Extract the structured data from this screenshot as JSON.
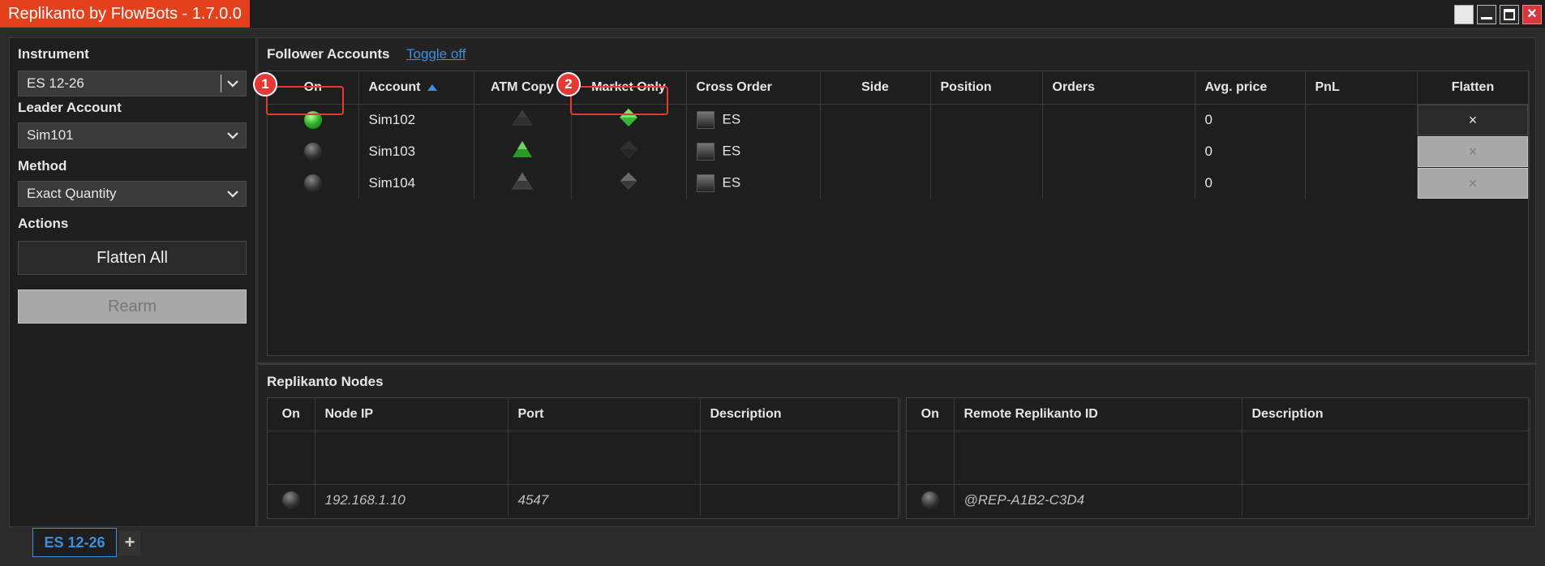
{
  "window": {
    "title": "Replikanto by FlowBots - 1.7.0.0"
  },
  "sidebar": {
    "instrument_label": "Instrument",
    "instrument_value": "ES 12-26",
    "leader_label": "Leader Account",
    "leader_value": "Sim101",
    "method_label": "Method",
    "method_value": "Exact Quantity",
    "actions_label": "Actions",
    "flatten_all_label": "Flatten All",
    "rearm_label": "Rearm"
  },
  "followers": {
    "title": "Follower Accounts",
    "toggle_link": "Toggle off",
    "columns": [
      "On",
      "Account",
      "ATM Copy",
      "Market Only",
      "Cross Order",
      "Side",
      "Position",
      "Orders",
      "Avg. price",
      "PnL",
      "Flatten"
    ],
    "rows": [
      {
        "on": true,
        "account": "Sim102",
        "atm_copy": false,
        "market_only": true,
        "cross_order": "ES",
        "side": "",
        "position": "",
        "orders": "",
        "avg_price": "0",
        "pnl": "",
        "flatten": "×",
        "flatten_enabled": true
      },
      {
        "on": false,
        "account": "Sim103",
        "atm_copy": true,
        "market_only": false,
        "cross_order": "ES",
        "side": "",
        "position": "",
        "orders": "",
        "avg_price": "0",
        "pnl": "",
        "flatten": "×",
        "flatten_enabled": false
      },
      {
        "on": false,
        "account": "Sim104",
        "atm_copy": false,
        "market_only": false,
        "cross_order": "ES",
        "side": "",
        "position": "",
        "orders": "",
        "avg_price": "0",
        "pnl": "",
        "flatten": "×",
        "flatten_enabled": false
      }
    ]
  },
  "markers": [
    "1",
    "2"
  ],
  "nodes": {
    "title": "Replikanto Nodes",
    "local_columns": [
      "On",
      "Node IP",
      "Port",
      "Description"
    ],
    "local_row": {
      "on": false,
      "ip": "192.168.1.10",
      "port": "4547",
      "description": ""
    },
    "remote_columns": [
      "On",
      "Remote Replikanto ID",
      "Description"
    ],
    "remote_row": {
      "on": false,
      "id": "@REP-A1B2-C3D4",
      "description": ""
    }
  },
  "tabs": {
    "active": "ES 12-26",
    "add": "+"
  },
  "colors": {
    "accent": "#3b8fe0",
    "title_bg": "#e4401c",
    "marker": "#e53935",
    "led_on": "#2fae2a"
  }
}
